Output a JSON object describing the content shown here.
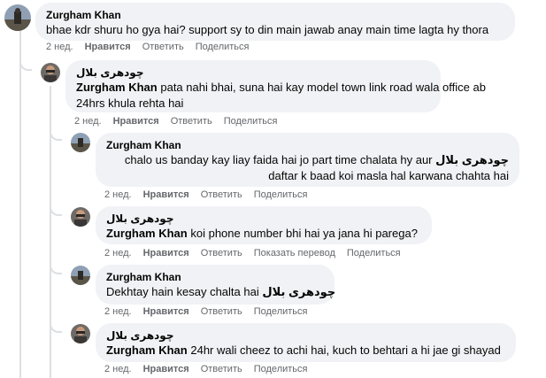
{
  "comments": [
    {
      "author": "Zurgham Khan",
      "text": "bhae kdr shuru ho gya hai? support sy to din main jawab anay main time lagta hy thora",
      "time": "2 нед.",
      "like": "Нравится",
      "reply": "Ответить",
      "share": "Поделиться"
    },
    {
      "author": "چودھری بلال",
      "mention": "Zurgham Khan",
      "text_line1": "pata nahi bhai, suna hai kay model town link road wala office ab",
      "text_line2": "24hrs khula rehta hai",
      "time": "2 нед.",
      "like": "Нравится",
      "reply": "Ответить",
      "share": "Поделиться"
    },
    {
      "author": "Zurgham Khan",
      "mention": "چودھری بلال",
      "text_line1": "chalo us banday kay liay faida hai jo part time chalata hy aur",
      "text_line2": "daftar k baad koi masla hal karwana chahta hai",
      "time": "2 нед.",
      "like": "Нравится",
      "reply": "Ответить",
      "share": "Поделиться"
    },
    {
      "author": "چودھری بلال",
      "mention": "Zurgham Khan",
      "text": "koi phone number bhi hai ya jana hi parega?",
      "time": "2 нед.",
      "like": "Нравится",
      "reply": "Ответить",
      "translate": "Показать перевод",
      "share": "Поделиться"
    },
    {
      "author": "Zurgham Khan",
      "mention": "چودھری بلال",
      "text": "Dekhtay hain kesay chalta hai",
      "time": "2 нед.",
      "like": "Нравится",
      "reply": "Ответить",
      "share": "Поделиться"
    },
    {
      "author": "چودھری بلال",
      "mention": "Zurgham Khan",
      "text": "24hr wali cheez to achi hai, kuch to behtari a hi jae gi shayad",
      "time": "2 нед.",
      "like": "Нравится",
      "reply": "Ответить",
      "share": "Поделиться"
    }
  ],
  "colors": {
    "bubble": "#f0f2f5",
    "meta": "#65676b",
    "thread_line": "#dddfe2"
  }
}
